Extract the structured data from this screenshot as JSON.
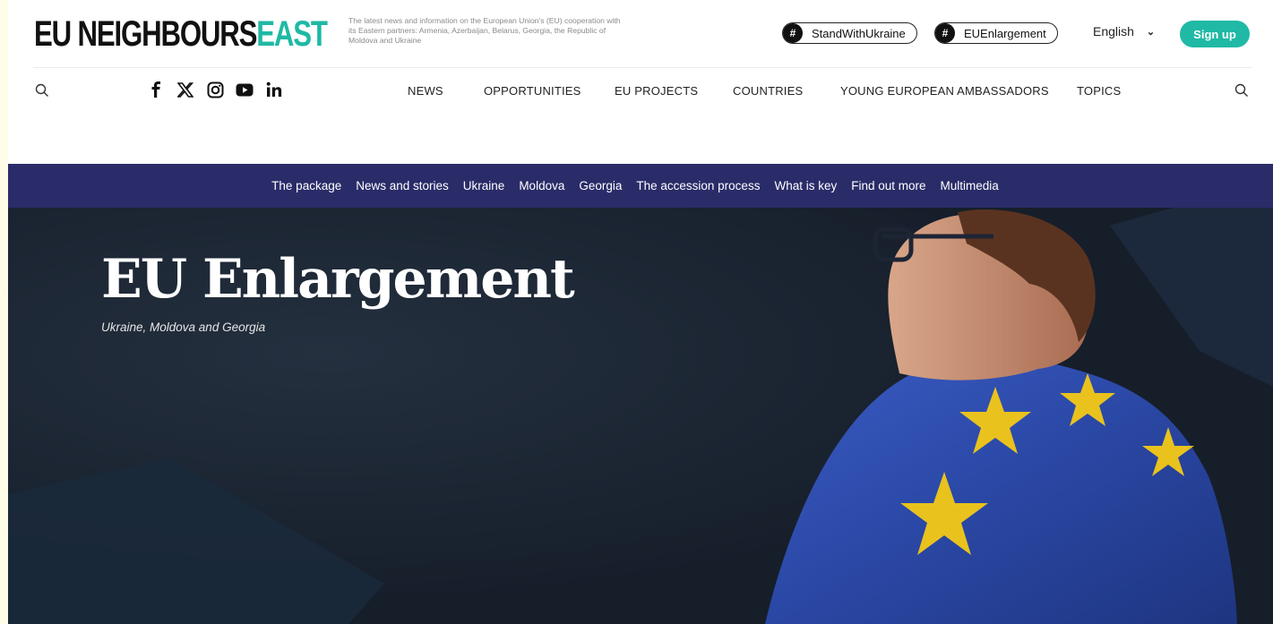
{
  "header": {
    "logo_part1": "EU NEIGHBOURS",
    "logo_part2": "EAST",
    "tagline": "The latest news and information on the European Union's (EU) cooperation with its Eastern partners: Armenia, Azerbaijan, Belarus, Georgia, the Republic of Moldova and Ukraine",
    "hashtags": [
      {
        "symbol": "#",
        "label": "StandWithUkraine"
      },
      {
        "symbol": "#",
        "label": "EUEnlargement"
      }
    ],
    "language": "English",
    "signup_label": "Sign up"
  },
  "social": [
    "f",
    "𝕏",
    "instagram",
    "youtube",
    "in"
  ],
  "main_nav": [
    "NEWS",
    "OPPORTUNITIES",
    "EU PROJECTS",
    "COUNTRIES",
    "YOUNG EUROPEAN AMBASSADORS",
    "TOPICS"
  ],
  "sub_nav": [
    "The package",
    "News and stories",
    "Ukraine",
    "Moldova",
    "Georgia",
    "The accession process",
    "What is key",
    "Find out more",
    "Multimedia"
  ],
  "hero": {
    "title": "EU Enlargement",
    "subtitle": "Ukraine, Moldova and Georgia"
  },
  "colors": {
    "accent": "#1fb9a5",
    "subnav_bg": "#2a2c69",
    "hero_bg": "#1b2533",
    "flag_blue": "#2f4fb0",
    "flag_star": "#e9c21e"
  }
}
